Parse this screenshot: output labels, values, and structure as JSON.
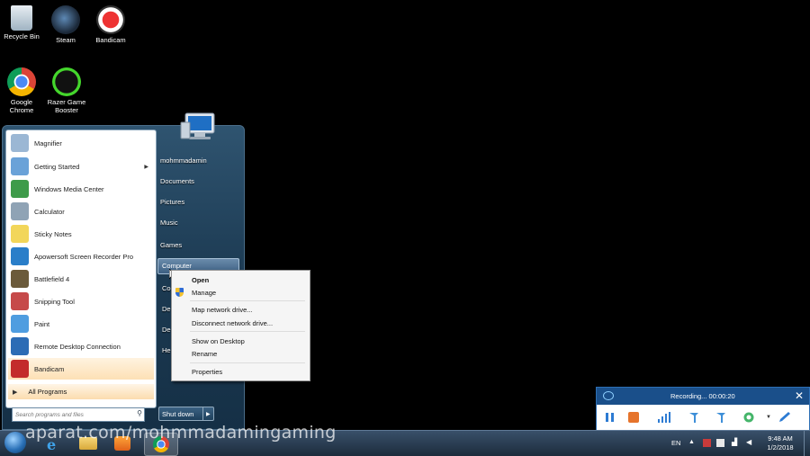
{
  "desktop": {
    "icons": [
      {
        "label": "Recycle Bin"
      },
      {
        "label": "Steam"
      },
      {
        "label": "Bandicam"
      },
      {
        "label": "Google Chrome"
      },
      {
        "label": "Razer Game Booster"
      }
    ]
  },
  "start_menu": {
    "programs": [
      {
        "label": "Magnifier",
        "icon": "magnifier-icon"
      },
      {
        "label": "Getting Started",
        "icon": "getting-started-icon",
        "submenu": true
      },
      {
        "label": "Windows Media Center",
        "icon": "media-center-icon"
      },
      {
        "label": "Calculator",
        "icon": "calculator-icon"
      },
      {
        "label": "Sticky Notes",
        "icon": "sticky-notes-icon"
      },
      {
        "label": "Apowersoft Screen Recorder Pro",
        "icon": "apowersoft-icon"
      },
      {
        "label": "Battlefield 4",
        "icon": "battlefield-icon"
      },
      {
        "label": "Snipping Tool",
        "icon": "snipping-tool-icon"
      },
      {
        "label": "Paint",
        "icon": "paint-icon"
      },
      {
        "label": "Remote Desktop Connection",
        "icon": "remote-desktop-icon"
      },
      {
        "label": "Bandicam",
        "icon": "bandicam-icon"
      }
    ],
    "all_programs": "All Programs",
    "search_placeholder": "Search programs and files",
    "right_items": {
      "user": "mohmmadamin",
      "documents": "Documents",
      "pictures": "Pictures",
      "music": "Music",
      "games": "Games",
      "computer": "Computer",
      "partial1": "Co",
      "partial2": "De",
      "partial3": "De",
      "partial4": "He"
    },
    "shutdown": "Shut down"
  },
  "context_menu": {
    "open": "Open",
    "manage": "Manage",
    "map_drive": "Map network drive...",
    "disconnect_drive": "Disconnect network drive...",
    "show_desktop": "Show on Desktop",
    "rename": "Rename",
    "properties": "Properties"
  },
  "recorder": {
    "status": "Recording... 00:00:20"
  },
  "taskbar": {
    "language": "EN",
    "time": "9:48 AM",
    "date": "1/2/2018"
  },
  "watermark": "aparat.com/mohmmadamingaming",
  "colors": {
    "start_menu_bg": "#1c3a52",
    "recorder_header": "#1a4f8a",
    "taskbar": "#2a3d52"
  }
}
